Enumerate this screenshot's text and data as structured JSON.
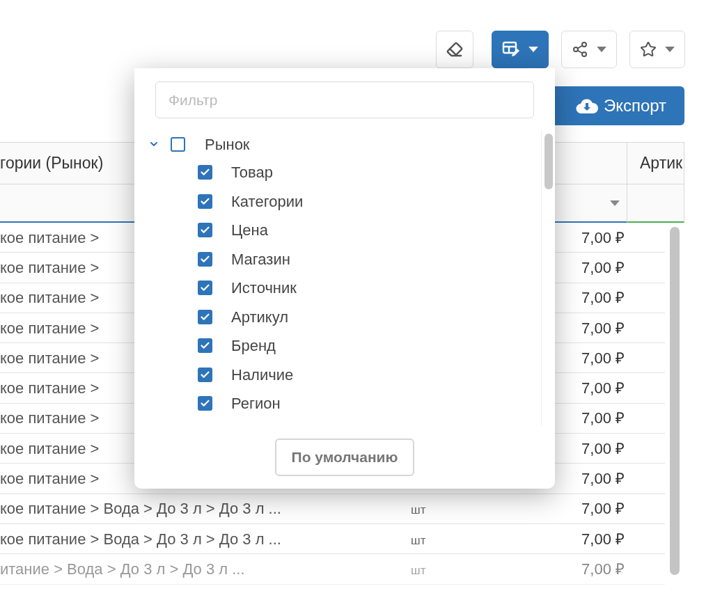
{
  "toolbar": [
    {
      "kind": "eraser",
      "active": false,
      "caret": false
    },
    {
      "kind": "columns",
      "active": true,
      "caret": true
    },
    {
      "kind": "share",
      "active": false,
      "caret": true
    },
    {
      "kind": "star",
      "active": false,
      "caret": true
    }
  ],
  "export_button": {
    "label": "Экспорт"
  },
  "table": {
    "column_1_header": "гории (Рынок)",
    "column_4_header": "Артик",
    "rows": [
      {
        "category": "кое питание >",
        "price": "7,00 ₽"
      },
      {
        "category": "кое питание >",
        "price": "7,00 ₽"
      },
      {
        "category": "кое питание >",
        "price": "7,00 ₽"
      },
      {
        "category": "кое питание >",
        "price": "7,00 ₽"
      },
      {
        "category": "кое питание >",
        "price": "7,00 ₽"
      },
      {
        "category": "кое питание >",
        "price": "7,00 ₽"
      },
      {
        "category": "кое питание >",
        "price": "7,00 ₽"
      },
      {
        "category": "кое питание >",
        "price": "7,00 ₽"
      },
      {
        "category": "кое питание >",
        "price": "7,00 ₽"
      },
      {
        "category": "кое питание > Вода > До 3 л > До 3 л ...",
        "unit": "шт",
        "price": "7,00 ₽"
      },
      {
        "category": "кое питание > Вода > До 3 л > До 3 л ...",
        "unit": "шт",
        "price": "7,00 ₽"
      },
      {
        "category": "итание > Вода > До 3 л > До 3 л ...",
        "unit": "шт",
        "price": "7,00 ₽"
      }
    ]
  },
  "columns_popup": {
    "filter": {
      "placeholder": "Фильтр"
    },
    "tree": [
      {
        "label": "Рынок",
        "checked": false,
        "expanded": true,
        "children": [
          {
            "label": "Товар",
            "checked": true
          },
          {
            "label": "Категории",
            "checked": true
          },
          {
            "label": "Цена",
            "checked": true
          },
          {
            "label": "Магазин",
            "checked": true
          },
          {
            "label": "Источник",
            "checked": true
          },
          {
            "label": "Артикул",
            "checked": true
          },
          {
            "label": "Бренд",
            "checked": true
          },
          {
            "label": "Наличие",
            "checked": true
          },
          {
            "label": "Регион",
            "checked": true
          }
        ]
      }
    ],
    "default_button": "По умолчанию"
  }
}
